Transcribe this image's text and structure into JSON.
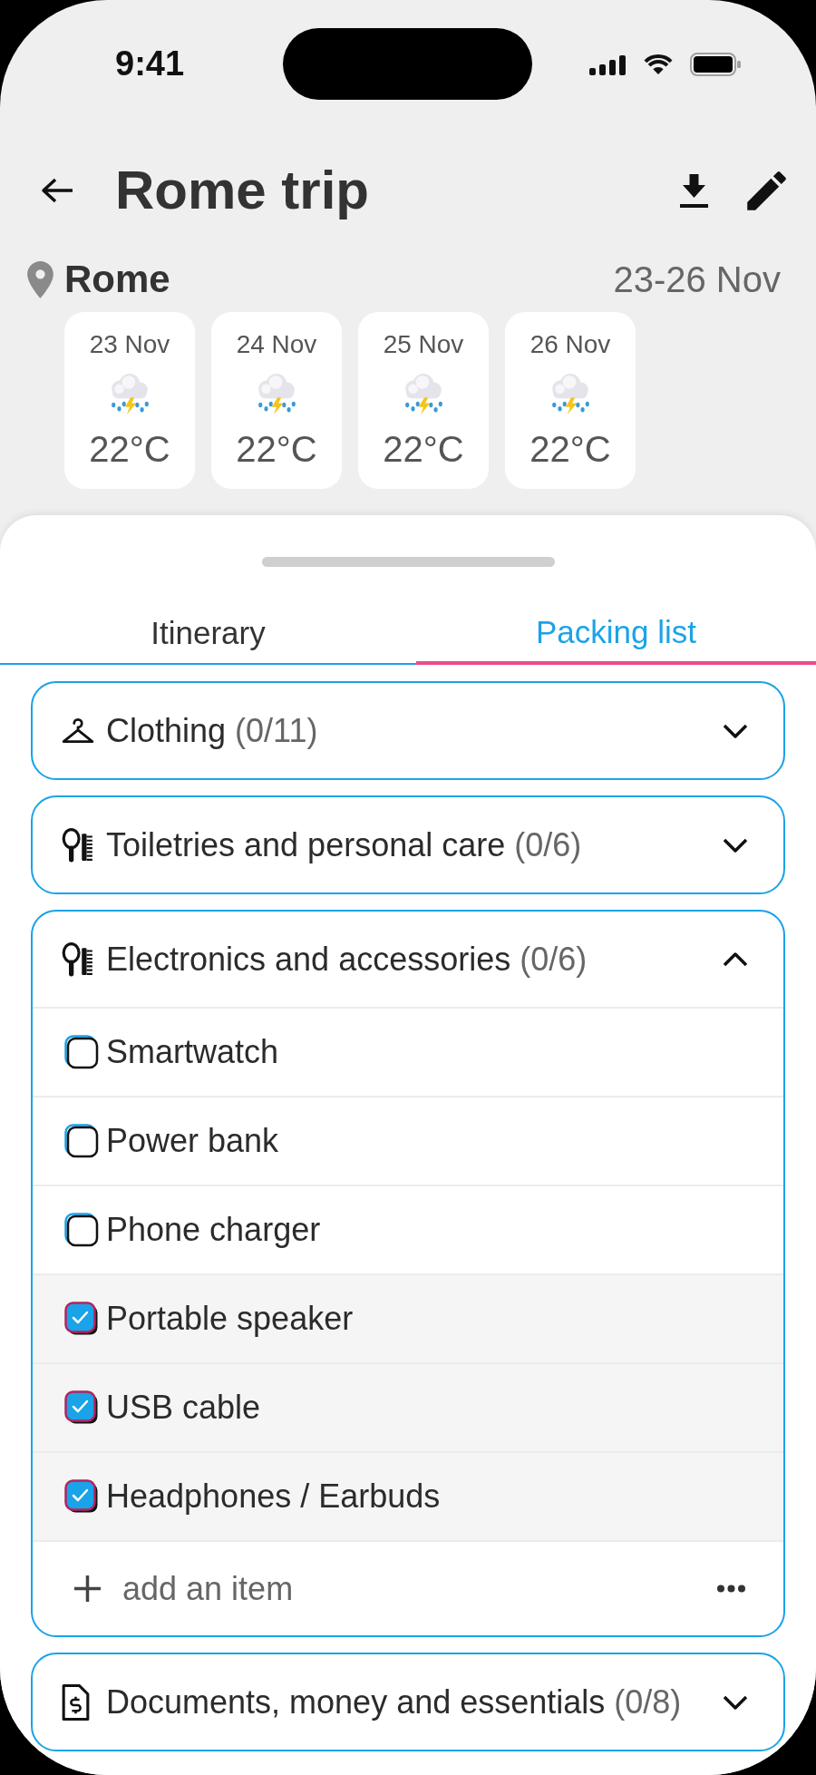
{
  "status_bar": {
    "time": "9:41"
  },
  "header": {
    "title": "Rome trip"
  },
  "trip": {
    "location": "Rome",
    "dates": "23-26 Nov"
  },
  "forecast": [
    {
      "date": "23 Nov",
      "temperature": "22°C"
    },
    {
      "date": "24 Nov",
      "temperature": "22°C"
    },
    {
      "date": "25 Nov",
      "temperature": "22°C"
    },
    {
      "date": "26 Nov",
      "temperature": "22°C"
    }
  ],
  "tabs": [
    {
      "label": "Itinerary",
      "selected": false
    },
    {
      "label": "Packing list",
      "selected": true
    }
  ],
  "categories": [
    {
      "name": "Clothing",
      "count": "(0/11)",
      "expanded": false
    },
    {
      "name": "Toiletries and personal care",
      "count": "(0/6)",
      "expanded": false
    },
    {
      "name": "Electronics and accessories",
      "count": "(0/6)",
      "expanded": true,
      "items": [
        {
          "label": "Smartwatch",
          "checked": false
        },
        {
          "label": "Power bank",
          "checked": false
        },
        {
          "label": "Phone charger",
          "checked": false
        },
        {
          "label": "Portable speaker",
          "checked": true
        },
        {
          "label": "USB cable",
          "checked": true
        },
        {
          "label": "Headphones / Earbuds",
          "checked": true
        }
      ],
      "add_item": "add an item"
    },
    {
      "name": "Documents, money and essentials",
      "count": "(0/8)",
      "expanded": false
    }
  ]
}
